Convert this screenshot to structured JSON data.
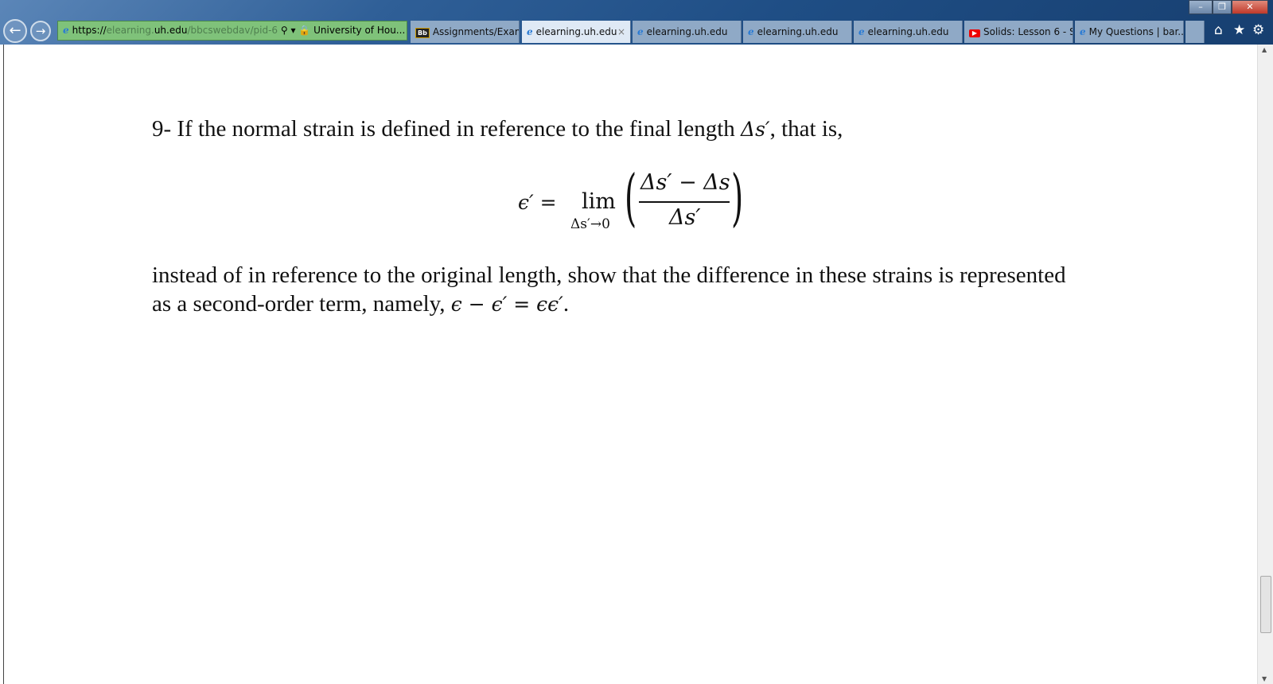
{
  "browser": {
    "address": {
      "scheme": "https://",
      "host_pre": "elearning.",
      "host": "uh.edu",
      "path": "/bbcswebdav/pid-6",
      "site_identity": "University of Hou...",
      "search_icon": "magnifier-icon",
      "refresh_icon": "refresh-icon",
      "lock_icon": "lock-icon"
    },
    "tabs": [
      {
        "label": "Assignments/Exam...",
        "icon": "blackboard-icon"
      },
      {
        "label": "elearning.uh.edu",
        "icon": "ie-icon",
        "active": true,
        "close": "×"
      },
      {
        "label": "elearning.uh.edu",
        "icon": "ie-icon"
      },
      {
        "label": "elearning.uh.edu",
        "icon": "ie-icon"
      },
      {
        "label": "elearning.uh.edu",
        "icon": "ie-icon"
      },
      {
        "label": "Solids: Lesson 6 - S...",
        "icon": "youtube-icon"
      },
      {
        "label": "My Questions | bar...",
        "icon": "ie-icon"
      }
    ]
  },
  "problem": {
    "intro": "9- If the normal strain is defined in reference to the final length",
    "intro_math": "Δs′",
    "intro_end": ", that is,",
    "eq_lhs": "ϵ′ =",
    "eq_lim": "lim",
    "eq_sub": "Δs′→0",
    "eq_num": "Δs′ − Δs",
    "eq_den": "Δs′",
    "line2": "instead of in reference to the original length, show that the difference in these strains is represented",
    "line3_pre": "as a second-order term, namely,",
    "line3_math": "ϵ − ϵ′ = ϵϵ′",
    "line3_end": "."
  }
}
